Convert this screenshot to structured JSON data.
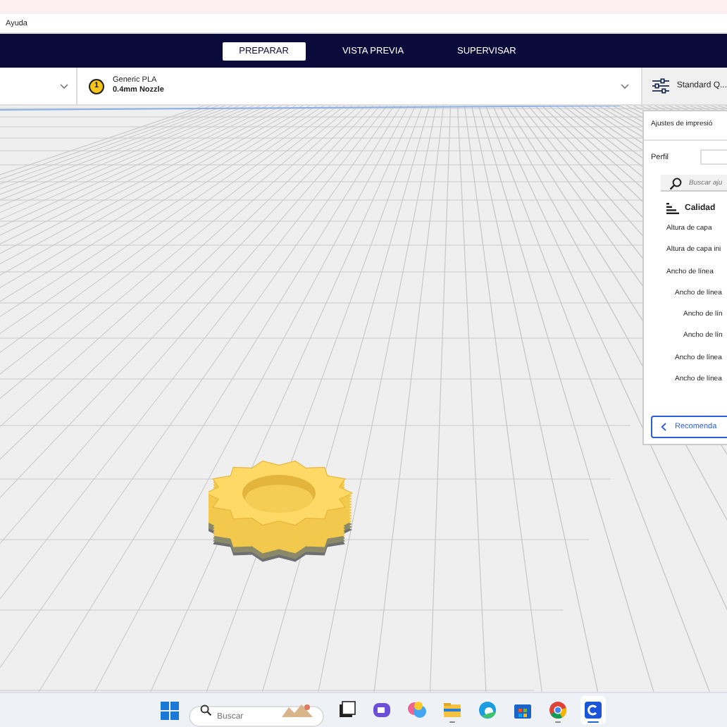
{
  "menu_bar": {
    "items": [
      "Ayuda"
    ]
  },
  "stages": [
    {
      "label": "PREPARAR",
      "selected": true
    },
    {
      "label": "VISTA PREVIA",
      "selected": false
    },
    {
      "label": "SUPERVISAR",
      "selected": false
    }
  ],
  "toolbar": {
    "extruder": {
      "number": "1",
      "material": "Generic PLA",
      "nozzle": "0.4mm Nozzle"
    },
    "profile": "Standard Q..."
  },
  "settings_panel": {
    "title": "Ajustes de impresió",
    "profile_label": "Perfil",
    "search": {
      "placeholder": "Buscar aju"
    },
    "category": "Calidad",
    "settings": [
      {
        "label": "Altura de capa"
      },
      {
        "label": "Altura de capa ini"
      },
      {
        "label": "Ancho de línea",
        "children": [
          {
            "label": "Ancho de línea",
            "children": [
              {
                "label": "Ancho de lín"
              },
              {
                "label": "Ancho de lín"
              }
            ]
          },
          {
            "label": "Ancho de línea"
          },
          {
            "label": "Ancho de línea"
          }
        ]
      }
    ],
    "recommended_button": "Recomenda"
  },
  "taskbar": {
    "search": {
      "placeholder": "Buscar"
    },
    "apps": [
      {
        "kind": "tiles",
        "running": false,
        "selected": false
      },
      {
        "kind": "chat",
        "running": false,
        "selected": false
      },
      {
        "kind": "copilot",
        "running": false,
        "selected": false
      },
      {
        "kind": "folder",
        "running": true,
        "selected": false
      },
      {
        "kind": "edge",
        "running": false,
        "selected": false
      },
      {
        "kind": "store",
        "running": false,
        "selected": false
      },
      {
        "kind": "chrome",
        "running": true,
        "selected": false
      },
      {
        "kind": "cura",
        "running": true,
        "selected": true
      }
    ]
  }
}
